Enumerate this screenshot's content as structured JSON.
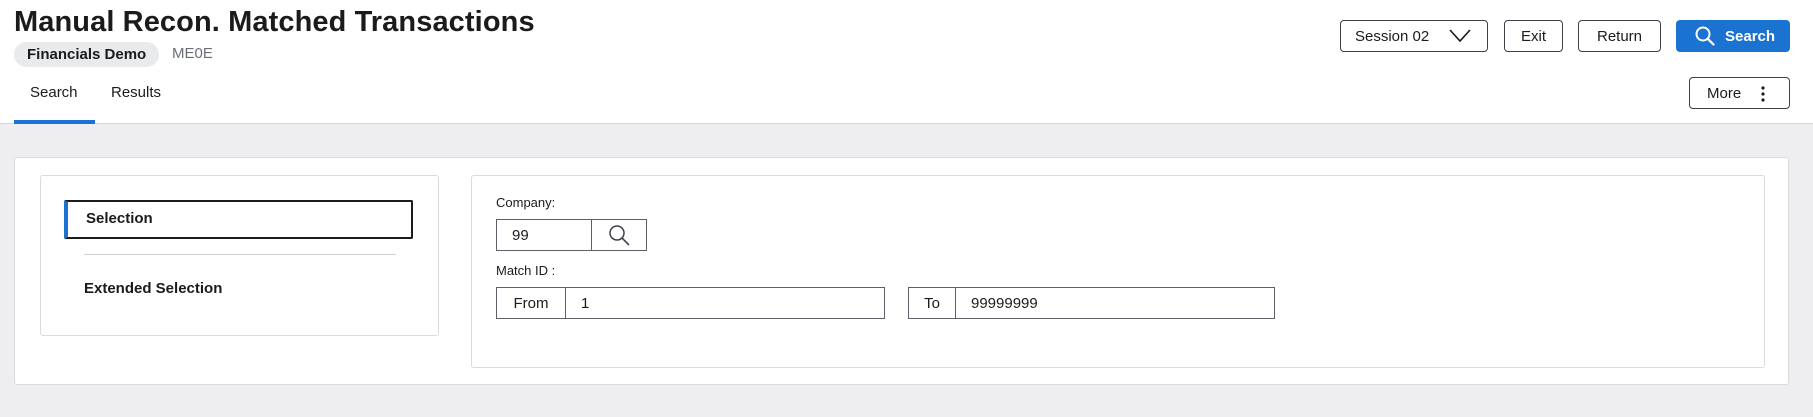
{
  "header": {
    "title": "Manual Recon. Matched Transactions",
    "company_name": "Financials Demo",
    "program_code": "ME0E"
  },
  "toolbar": {
    "session_label": "Session 02",
    "exit_label": "Exit",
    "return_label": "Return",
    "search_label": "Search",
    "more_label": "More",
    "accent_color": "#1a73d1"
  },
  "tabs": [
    {
      "label": "Search",
      "active": true
    },
    {
      "label": "Results",
      "active": false
    }
  ],
  "sidebar": {
    "items": [
      {
        "label": "Selection",
        "active": true
      },
      {
        "label": "Extended Selection",
        "active": false
      }
    ]
  },
  "form": {
    "company": {
      "label": "Company:",
      "value": "99",
      "icon": "search-icon"
    },
    "match_id": {
      "label": "Match ID :",
      "from_label": "From",
      "from_value": "1",
      "to_label": "To",
      "to_value": "99999999"
    }
  }
}
